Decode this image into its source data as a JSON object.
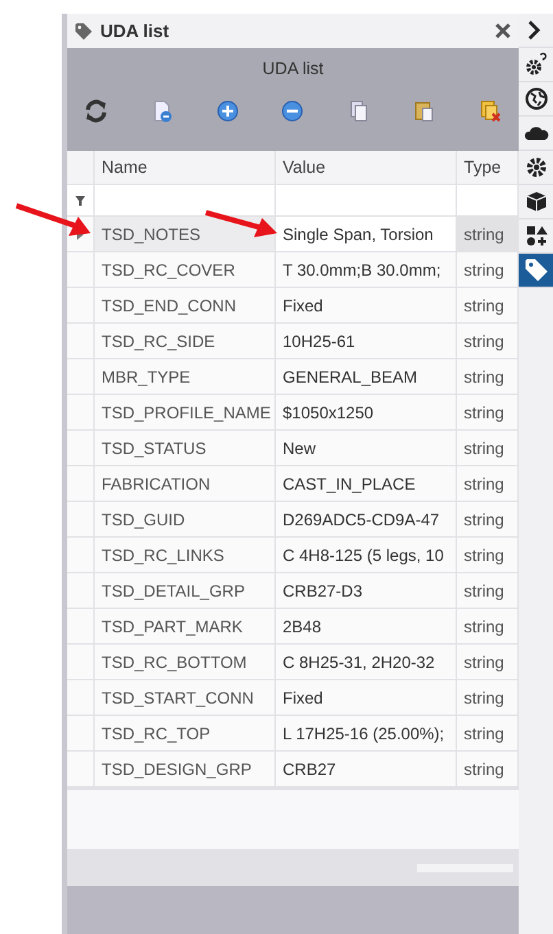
{
  "panel": {
    "title": "UDA list",
    "header": "UDA list"
  },
  "toolbar": [
    {
      "kind": "refresh"
    },
    {
      "kind": "remove-doc"
    },
    {
      "kind": "add"
    },
    {
      "kind": "remove"
    },
    {
      "kind": "copy"
    },
    {
      "kind": "paste"
    },
    {
      "kind": "delete"
    }
  ],
  "table": {
    "columns": [
      "Name",
      "Value",
      "Type"
    ],
    "rows": [
      {
        "name": "TSD_NOTES",
        "value": "Single Span, Torsion",
        "type": "string",
        "selected": true
      },
      {
        "name": "TSD_RC_COVER",
        "value": "T 30.0mm;B 30.0mm;",
        "type": "string",
        "selected": false
      },
      {
        "name": "TSD_END_CONN",
        "value": "Fixed",
        "type": "string",
        "selected": false
      },
      {
        "name": "TSD_RC_SIDE",
        "value": "10H25-61",
        "type": "string",
        "selected": false
      },
      {
        "name": "MBR_TYPE",
        "value": "GENERAL_BEAM",
        "type": "string",
        "selected": false
      },
      {
        "name": "TSD_PROFILE_NAME",
        "value": "$1050x1250",
        "type": "string",
        "selected": false
      },
      {
        "name": "TSD_STATUS",
        "value": "New",
        "type": "string",
        "selected": false
      },
      {
        "name": "FABRICATION",
        "value": "CAST_IN_PLACE",
        "type": "string",
        "selected": false
      },
      {
        "name": "TSD_GUID",
        "value": "D269ADC5-CD9A-47",
        "type": "string",
        "selected": false
      },
      {
        "name": "TSD_RC_LINKS",
        "value": "C 4H8-125 (5 legs, 10",
        "type": "string",
        "selected": false
      },
      {
        "name": "TSD_DETAIL_GRP",
        "value": "CRB27-D3",
        "type": "string",
        "selected": false
      },
      {
        "name": "TSD_PART_MARK",
        "value": "2B48",
        "type": "string",
        "selected": false
      },
      {
        "name": "TSD_RC_BOTTOM",
        "value": "C 8H25-31, 2H20-32",
        "type": "string",
        "selected": false
      },
      {
        "name": "TSD_START_CONN",
        "value": "Fixed",
        "type": "string",
        "selected": false
      },
      {
        "name": "TSD_RC_TOP",
        "value": "L 17H25-16 (25.00%);",
        "type": "string",
        "selected": false
      },
      {
        "name": "TSD_DESIGN_GRP",
        "value": "CRB27",
        "type": "string",
        "selected": false
      }
    ]
  },
  "sidebar": [
    {
      "kind": "expand",
      "selected": false
    },
    {
      "kind": "gear-help",
      "selected": false
    },
    {
      "kind": "globe",
      "selected": false
    },
    {
      "kind": "cloud",
      "selected": false
    },
    {
      "kind": "gear",
      "selected": false
    },
    {
      "kind": "cube",
      "selected": false
    },
    {
      "kind": "shapes",
      "selected": false
    },
    {
      "kind": "tag",
      "selected": true
    }
  ]
}
